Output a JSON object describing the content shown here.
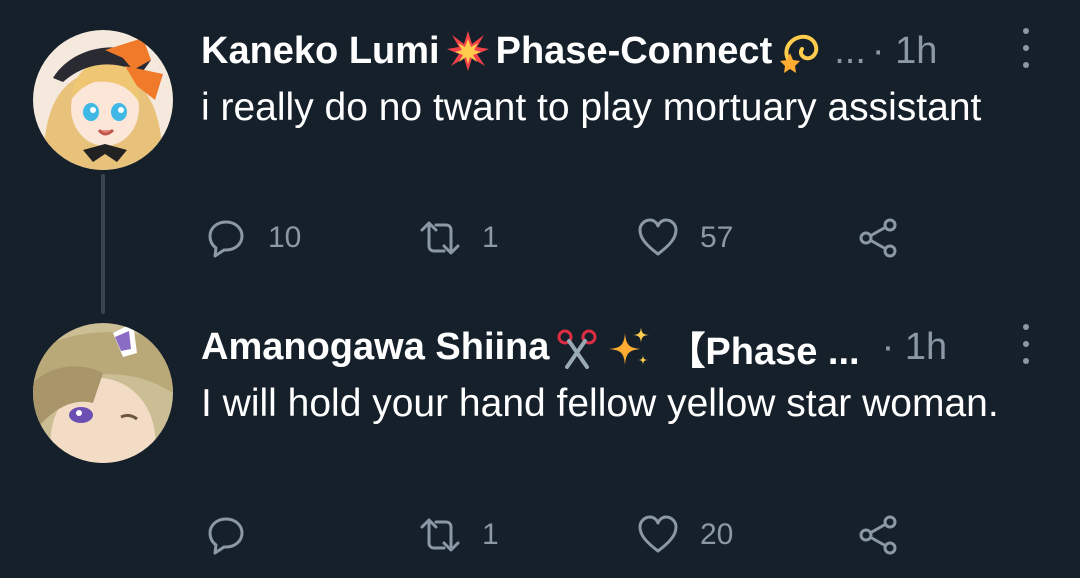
{
  "colors": {
    "background": "#15202b",
    "text": "#ffffff",
    "muted": "#8b98a5",
    "thread_line": "#38444d"
  },
  "tweets": [
    {
      "author": "Kaneko Lumi",
      "emoji1": "collision-emoji",
      "org": "Phase-Connect",
      "emoji2": "dizzy-emoji",
      "separator": "...",
      "time": "· 1h",
      "text": "i really do no twant to play mortuary assistant",
      "replies": "10",
      "retweets": "1",
      "likes": "57"
    },
    {
      "author": "Amanogawa Shiina",
      "emoji1": "scissors-emoji",
      "emoji2": "sparkles-emoji",
      "org": "【Phase ...",
      "time": "· 1h",
      "text": "I will hold your hand fellow yellow star woman.",
      "replies": "",
      "retweets": "1",
      "likes": "20"
    }
  ]
}
